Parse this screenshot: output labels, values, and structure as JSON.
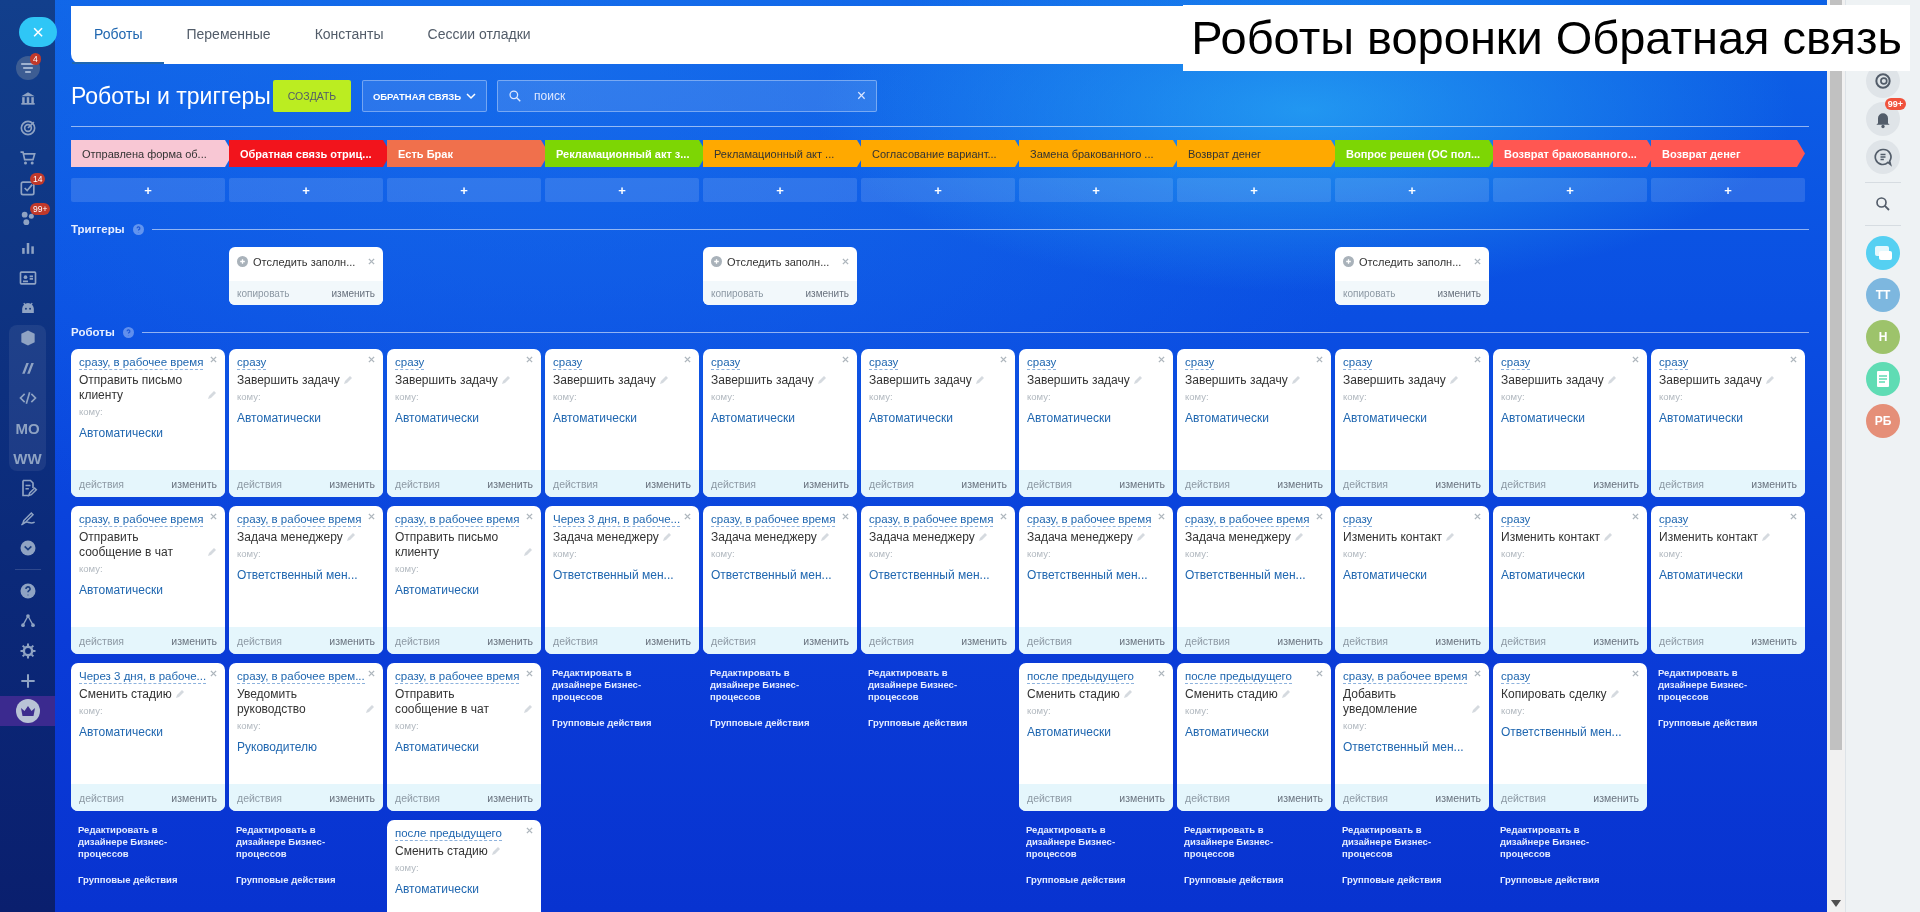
{
  "caption": "Роботы воронки Обратная связь",
  "left_sidebar": {
    "close": "×",
    "items": [
      {
        "badge": "4",
        "selected": false
      },
      {
        "selected": false
      },
      {
        "selected": false
      },
      {
        "selected": false
      },
      {
        "badge": "14",
        "selected": false
      },
      {
        "badge": "99+",
        "selected": false
      },
      {
        "selected": false
      },
      {
        "selected": false
      },
      {
        "selected": false
      },
      {
        "selected": false
      },
      {
        "selected": false
      },
      {
        "selected": false
      },
      {
        "text": "MO",
        "selected": false
      },
      {
        "text": "WW",
        "selected": false
      },
      {
        "selected": false
      },
      {
        "selected": false
      },
      {
        "selected": false
      },
      {
        "selected": false
      },
      {
        "selected": false
      },
      {
        "selected": false
      },
      {
        "selected": false
      },
      {
        "selected": true
      }
    ]
  },
  "right_panel": {
    "notifications_badge": "99+",
    "avatars": [
      {
        "kind": "chat",
        "color": "#55d0f2"
      },
      {
        "kind": "initials",
        "initials": "ТТ",
        "color": "#7db7df"
      },
      {
        "kind": "initials",
        "initials": "Н",
        "color": "#9dc36b"
      },
      {
        "kind": "document",
        "color": "#5fdcb4"
      },
      {
        "kind": "initials",
        "initials": "РБ",
        "color": "#e58f78"
      }
    ]
  },
  "tabs": [
    {
      "label": "Роботы",
      "selected": true
    },
    {
      "label": "Переменные",
      "selected": false
    },
    {
      "label": "Константы",
      "selected": false
    },
    {
      "label": "Сессии отладки",
      "selected": false
    }
  ],
  "header": {
    "title": "Роботы и триггеры",
    "create": "СОЗДАТЬ",
    "pipeline": "ОБРАТНАЯ СВЯЗЬ",
    "search": {
      "placeholder": "поиск",
      "clear": "×"
    }
  },
  "triggers_title": "Триггеры",
  "robots_title": "Роботы",
  "columns": [
    {
      "stage": {
        "label": "Отправлена форма об...",
        "color": "#f8c7d4"
      },
      "add": "+",
      "robots": [
        {
          "delay": "сразу, в рабочее время",
          "name": "Отправить письмо клиенту",
          "to_label": "кому:",
          "to": "Автоматически",
          "actions": "действия",
          "edit": "изменить"
        },
        {
          "delay": "сразу, в рабочее время",
          "name": "Отправить сообщение в чат",
          "to_label": "кому:",
          "to": "Автоматически",
          "actions": "действия",
          "edit": "изменить"
        },
        {
          "delay": "Через 3 дня, в рабоче...",
          "name": "Сменить стадию",
          "to_label": "кому:",
          "to": "Автоматически",
          "actions": "действия",
          "edit": "изменить"
        }
      ],
      "design_link": "Редактировать в дизайнере Бизнес-процессов",
      "group_link": "Групповые действия"
    },
    {
      "stage": {
        "label": "Обратная связь отриц...",
        "color": "#f2141c"
      },
      "add": "+",
      "trigger": {
        "name": "Отследить заполн...",
        "copy": "копировать",
        "edit": "изменить"
      },
      "robots": [
        {
          "delay": "сразу",
          "name": "Завершить задачу",
          "to_label": "кому:",
          "to": "Автоматически",
          "actions": "действия",
          "edit": "изменить"
        },
        {
          "delay": "сразу, в рабочее время",
          "name": "Задача менеджеру",
          "to_label": "кому:",
          "to": "Ответственный мен...",
          "actions": "действия",
          "edit": "изменить"
        },
        {
          "delay": "сразу, в рабочее врем...",
          "name": "Уведомить руководство",
          "to_label": "кому:",
          "to": "Руководителю",
          "actions": "действия",
          "edit": "изменить"
        }
      ],
      "design_link": "Редактировать в дизайнере Бизнес-процессов",
      "group_link": "Групповые действия"
    },
    {
      "stage": {
        "label": "Есть Брак",
        "color": "#f0704c"
      },
      "add": "+",
      "robots": [
        {
          "delay": "сразу",
          "name": "Завершить задачу",
          "to_label": "кому:",
          "to": "Автоматически",
          "actions": "действия",
          "edit": "изменить"
        },
        {
          "delay": "сразу, в рабочее время",
          "name": "Отправить письмо клиенту",
          "to_label": "кому:",
          "to": "Автоматически",
          "actions": "действия",
          "edit": "изменить"
        },
        {
          "delay": "сразу, в рабочее время",
          "name": "Отправить сообщение в чат",
          "to_label": "кому:",
          "to": "Автоматически",
          "actions": "действия",
          "edit": "изменить"
        },
        {
          "delay": "после предыдущего",
          "name": "Сменить стадию",
          "to_label": "кому:",
          "to": "Автоматически"
        }
      ]
    },
    {
      "stage": {
        "label": "Рекламационный акт з...",
        "color": "#7dd604"
      },
      "add": "+",
      "robots": [
        {
          "delay": "сразу",
          "name": "Завершить задачу",
          "to_label": "кому:",
          "to": "Автоматически",
          "actions": "действия",
          "edit": "изменить"
        },
        {
          "delay": "Через 3 дня, в рабоче...",
          "name": "Задача менеджеру",
          "to_label": "кому:",
          "to": "Ответственный мен...",
          "actions": "действия",
          "edit": "изменить"
        }
      ],
      "design_link": "Редактировать в дизайнере Бизнес-процессов",
      "group_link": "Групповые действия"
    },
    {
      "stage": {
        "label": "Рекламационный акт ...",
        "color": "#ffa900"
      },
      "add": "+",
      "trigger": {
        "name": "Отследить заполн...",
        "copy": "копировать",
        "edit": "изменить"
      },
      "robots": [
        {
          "delay": "сразу",
          "name": "Завершить задачу",
          "to_label": "кому:",
          "to": "Автоматически",
          "actions": "действия",
          "edit": "изменить"
        },
        {
          "delay": "сразу, в рабочее время",
          "name": "Задача менеджеру",
          "to_label": "кому:",
          "to": "Ответственный мен...",
          "actions": "действия",
          "edit": "изменить"
        }
      ],
      "design_link": "Редактировать в дизайнере Бизнес-процессов",
      "group_link": "Групповые действия"
    },
    {
      "stage": {
        "label": "Согласование вариант...",
        "color": "#ffa900"
      },
      "add": "+",
      "robots": [
        {
          "delay": "сразу",
          "name": "Завершить задачу",
          "to_label": "кому:",
          "to": "Автоматически",
          "actions": "действия",
          "edit": "изменить"
        },
        {
          "delay": "сразу, в рабочее время",
          "name": "Задача менеджеру",
          "to_label": "кому:",
          "to": "Ответственный мен...",
          "actions": "действия",
          "edit": "изменить"
        }
      ],
      "design_link": "Редактировать в дизайнере Бизнес-процессов",
      "group_link": "Групповые действия"
    },
    {
      "stage": {
        "label": "Замена бракованного ...",
        "color": "#ffa900"
      },
      "add": "+",
      "robots": [
        {
          "delay": "сразу",
          "name": "Завершить задачу",
          "to_label": "кому:",
          "to": "Автоматически",
          "actions": "действия",
          "edit": "изменить"
        },
        {
          "delay": "сразу, в рабочее время",
          "name": "Задача менеджеру",
          "to_label": "кому:",
          "to": "Ответственный мен...",
          "actions": "действия",
          "edit": "изменить"
        },
        {
          "delay": "после предыдущего",
          "name": "Сменить стадию",
          "to_label": "кому:",
          "to": "Автоматически",
          "actions": "действия",
          "edit": "изменить"
        }
      ],
      "design_link": "Редактировать в дизайнере Бизнес-процессов",
      "group_link": "Групповые действия"
    },
    {
      "stage": {
        "label": "Возврат денег",
        "color": "#ffa900"
      },
      "add": "+",
      "robots": [
        {
          "delay": "сразу",
          "name": "Завершить задачу",
          "to_label": "кому:",
          "to": "Автоматически",
          "actions": "действия",
          "edit": "изменить"
        },
        {
          "delay": "сразу, в рабочее время",
          "name": "Задача менеджеру",
          "to_label": "кому:",
          "to": "Ответственный мен...",
          "actions": "действия",
          "edit": "изменить"
        },
        {
          "delay": "после предыдущего",
          "name": "Сменить стадию",
          "to_label": "кому:",
          "to": "Автоматически",
          "actions": "действия",
          "edit": "изменить"
        }
      ],
      "design_link": "Редактировать в дизайнере Бизнес-процессов",
      "group_link": "Групповые действия"
    },
    {
      "stage": {
        "label": "Вопрос решен (ОС пол...",
        "color": "#7dd604"
      },
      "add": "+",
      "trigger": {
        "name": "Отследить заполн...",
        "copy": "копировать",
        "edit": "изменить"
      },
      "robots": [
        {
          "delay": "сразу",
          "name": "Завершить задачу",
          "to_label": "кому:",
          "to": "Автоматически",
          "actions": "действия",
          "edit": "изменить"
        },
        {
          "delay": "сразу",
          "name": "Изменить контакт",
          "to_label": "кому:",
          "to": "Автоматически",
          "actions": "действия",
          "edit": "изменить"
        },
        {
          "delay": "сразу, в рабочее время",
          "name": "Добавить уведомление",
          "to_label": "кому:",
          "to": "Ответственный мен...",
          "actions": "действия",
          "edit": "изменить"
        }
      ],
      "design_link": "Редактировать в дизайнере Бизнес-процессов",
      "group_link": "Групповые действия"
    },
    {
      "stage": {
        "label": "Возврат бракованного...",
        "color": "#ff5752"
      },
      "add": "+",
      "robots": [
        {
          "delay": "сразу",
          "name": "Завершить задачу",
          "to_label": "кому:",
          "to": "Автоматически",
          "actions": "действия",
          "edit": "изменить"
        },
        {
          "delay": "сразу",
          "name": "Изменить контакт",
          "to_label": "кому:",
          "to": "Автоматически",
          "actions": "действия",
          "edit": "изменить"
        },
        {
          "delay": "сразу",
          "name": "Копировать сделку",
          "to_label": "кому:",
          "to": "Ответственный мен...",
          "actions": "действия",
          "edit": "изменить"
        }
      ],
      "design_link": "Редактировать в дизайнере Бизнес-процессов",
      "group_link": "Групповые действия"
    },
    {
      "stage": {
        "label": "Возврат денег",
        "color": "#ff5752"
      },
      "add": "+",
      "robots": [
        {
          "delay": "сразу",
          "name": "Завершить задачу",
          "to_label": "кому:",
          "to": "Автоматически",
          "actions": "действия",
          "edit": "изменить"
        },
        {
          "delay": "сразу",
          "name": "Изменить контакт",
          "to_label": "кому:",
          "to": "Автоматически",
          "actions": "действия",
          "edit": "изменить"
        }
      ],
      "design_link": "Редактировать в дизайнере Бизнес-процессов",
      "group_link": "Групповые действия"
    }
  ]
}
